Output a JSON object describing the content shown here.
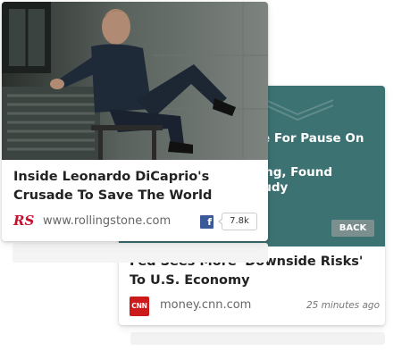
{
  "cards": {
    "front": {
      "image_icon": "photo-image",
      "headline": "Inside Leonardo DiCaprio's Crusade To Save The World",
      "source_logo_text": "RS",
      "source_logo_color": "#c8102e",
      "domain": "www.rollingstone.com",
      "share_icon": "facebook-icon",
      "share_icon_letter": "f",
      "share_count": "7.8k"
    },
    "back": {
      "panel_color": "#3d7272",
      "panel_lines": [
        "se For Pause On",
        "ting, Found",
        "oudy"
      ],
      "back_button_label": "BACK",
      "headline": "Fed Sees More 'Downside Risks' To U.S. Economy",
      "source_logo_text": "CNN",
      "source_logo_color": "#cc1a1a",
      "domain": "money.cnn.com",
      "timestamp": "25 minutes ago"
    }
  }
}
